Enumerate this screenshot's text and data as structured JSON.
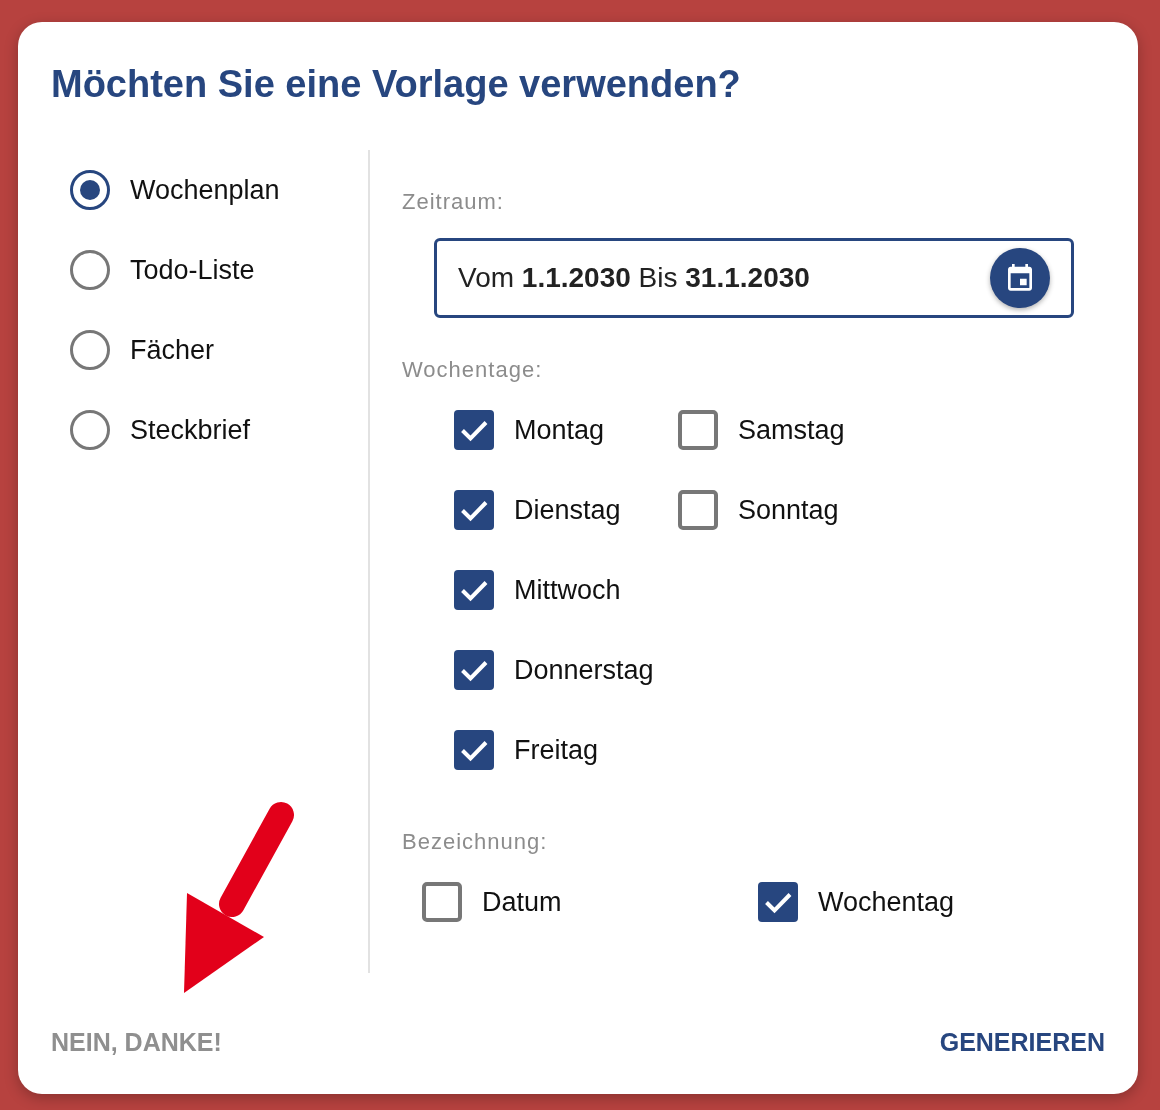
{
  "dialog": {
    "title": "Möchten Sie eine Vorlage verwenden?"
  },
  "templates": [
    {
      "label": "Wochenplan",
      "selected": true
    },
    {
      "label": "Todo-Liste",
      "selected": false
    },
    {
      "label": "Fächer",
      "selected": false
    },
    {
      "label": "Steckbrief",
      "selected": false
    }
  ],
  "period": {
    "label": "Zeitraum:",
    "value": "Vom **1.1.2030** Bis **31.1.2030**"
  },
  "weekdays": {
    "label": "Wochentage:",
    "items": [
      {
        "label": "Montag",
        "checked": true
      },
      {
        "label": "Dienstag",
        "checked": true
      },
      {
        "label": "Mittwoch",
        "checked": true
      },
      {
        "label": "Donnerstag",
        "checked": true
      },
      {
        "label": "Freitag",
        "checked": true
      },
      {
        "label": "Samstag",
        "checked": false
      },
      {
        "label": "Sonntag",
        "checked": false
      }
    ]
  },
  "naming": {
    "label": "Bezeichnung:",
    "items": [
      {
        "label": "Datum",
        "checked": false
      },
      {
        "label": "Wochentag",
        "checked": true
      }
    ]
  },
  "buttons": [
    {
      "label": "NEIN, DANKE!",
      "kind": "secondary"
    },
    {
      "label": "GENERIEREN",
      "kind": "primary"
    }
  ]
}
